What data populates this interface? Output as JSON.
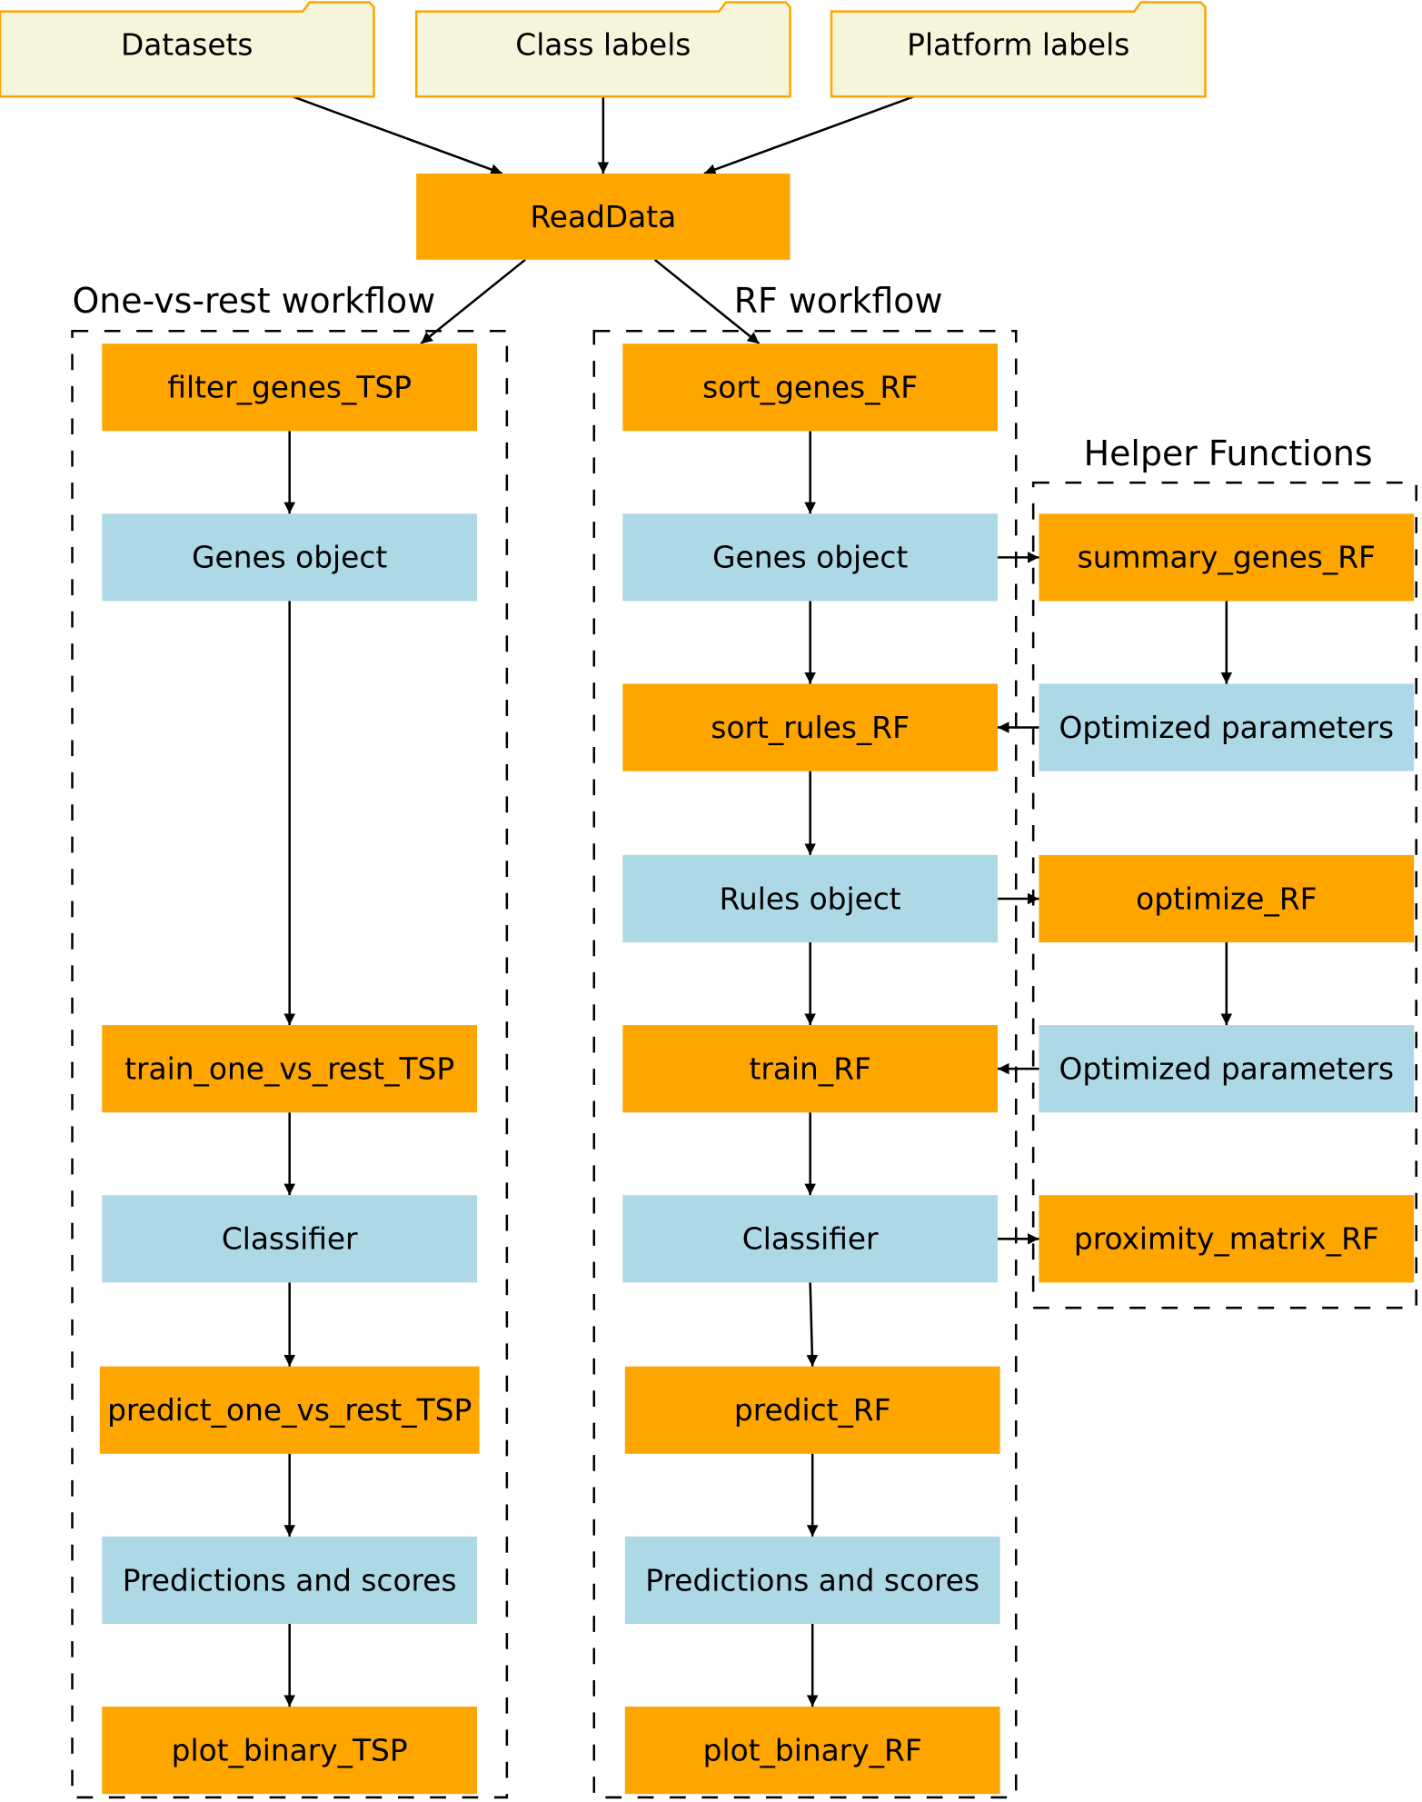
{
  "colors": {
    "process": "#FFA500",
    "object": "#ADD8E6",
    "input": "#F5F5DC",
    "input_border": "#FFA500"
  },
  "inputs": [
    {
      "id": "datasets",
      "label": "Datasets"
    },
    {
      "id": "class_labels",
      "label": "Class labels"
    },
    {
      "id": "platform_labels",
      "label": "Platform labels"
    }
  ],
  "read_data": {
    "id": "readdata",
    "label": "ReadData",
    "kind": "process"
  },
  "groups": {
    "one_vs_rest": {
      "title": "One-vs-rest workflow",
      "nodes": [
        {
          "id": "filter_genes_TSP",
          "label": "filter_genes_TSP",
          "kind": "process"
        },
        {
          "id": "ovr_genes_object",
          "label": "Genes object",
          "kind": "object"
        },
        {
          "id": "train_one_vs_rest_TSP",
          "label": "train_one_vs_rest_TSP",
          "kind": "process"
        },
        {
          "id": "ovr_classifier",
          "label": "Classifier",
          "kind": "object"
        },
        {
          "id": "predict_one_vs_rest_TSP",
          "label": "predict_one_vs_rest_TSP",
          "kind": "process"
        },
        {
          "id": "ovr_predictions",
          "label": "Predictions and scores",
          "kind": "object"
        },
        {
          "id": "plot_binary_TSP",
          "label": "plot_binary_TSP",
          "kind": "process"
        }
      ]
    },
    "rf": {
      "title": "RF workflow",
      "nodes": [
        {
          "id": "sort_genes_RF",
          "label": "sort_genes_RF",
          "kind": "process"
        },
        {
          "id": "rf_genes_object",
          "label": "Genes object",
          "kind": "object"
        },
        {
          "id": "sort_rules_RF",
          "label": "sort_rules_RF",
          "kind": "process"
        },
        {
          "id": "rules_object",
          "label": "Rules object",
          "kind": "object"
        },
        {
          "id": "train_RF",
          "label": "train_RF",
          "kind": "process"
        },
        {
          "id": "rf_classifier",
          "label": "Classifier",
          "kind": "object"
        },
        {
          "id": "predict_RF",
          "label": "predict_RF",
          "kind": "process"
        },
        {
          "id": "rf_predictions",
          "label": "Predictions and scores",
          "kind": "object"
        },
        {
          "id": "plot_binary_RF",
          "label": "plot_binary_RF",
          "kind": "process"
        }
      ]
    },
    "helpers": {
      "title": "Helper Functions",
      "nodes": [
        {
          "id": "summary_genes_RF",
          "label": "summary_genes_RF",
          "kind": "process"
        },
        {
          "id": "opt_params_1",
          "label": "Optimized parameters",
          "kind": "object"
        },
        {
          "id": "optimize_RF",
          "label": "optimize_RF",
          "kind": "process"
        },
        {
          "id": "opt_params_2",
          "label": "Optimized parameters",
          "kind": "object"
        },
        {
          "id": "proximity_matrix_RF",
          "label": "proximity_matrix_RF",
          "kind": "process"
        }
      ]
    }
  },
  "edges": [
    [
      "datasets",
      "readdata"
    ],
    [
      "class_labels",
      "readdata"
    ],
    [
      "platform_labels",
      "readdata"
    ],
    [
      "readdata",
      "filter_genes_TSP"
    ],
    [
      "readdata",
      "sort_genes_RF"
    ],
    [
      "filter_genes_TSP",
      "ovr_genes_object"
    ],
    [
      "ovr_genes_object",
      "train_one_vs_rest_TSP"
    ],
    [
      "train_one_vs_rest_TSP",
      "ovr_classifier"
    ],
    [
      "ovr_classifier",
      "predict_one_vs_rest_TSP"
    ],
    [
      "predict_one_vs_rest_TSP",
      "ovr_predictions"
    ],
    [
      "ovr_predictions",
      "plot_binary_TSP"
    ],
    [
      "sort_genes_RF",
      "rf_genes_object"
    ],
    [
      "rf_genes_object",
      "sort_rules_RF"
    ],
    [
      "sort_rules_RF",
      "rules_object"
    ],
    [
      "rules_object",
      "train_RF"
    ],
    [
      "train_RF",
      "rf_classifier"
    ],
    [
      "rf_classifier",
      "predict_RF"
    ],
    [
      "predict_RF",
      "rf_predictions"
    ],
    [
      "rf_predictions",
      "plot_binary_RF"
    ],
    [
      "rf_genes_object",
      "summary_genes_RF"
    ],
    [
      "summary_genes_RF",
      "opt_params_1"
    ],
    [
      "opt_params_1",
      "sort_rules_RF"
    ],
    [
      "rules_object",
      "optimize_RF"
    ],
    [
      "optimize_RF",
      "opt_params_2"
    ],
    [
      "opt_params_2",
      "train_RF"
    ],
    [
      "rf_classifier",
      "proximity_matrix_RF"
    ]
  ]
}
